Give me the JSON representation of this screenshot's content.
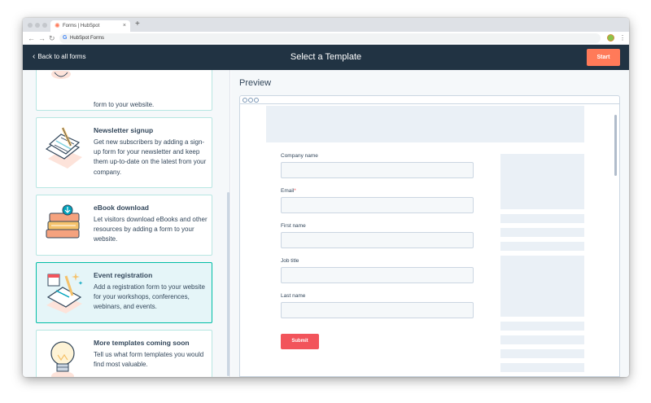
{
  "browser": {
    "tab_title": "Forms | HubSpot",
    "tab_close": "×",
    "new_tab": "+",
    "url": "HubSpot Forms",
    "google_glyph": "G",
    "nav": {
      "back": "←",
      "forward": "→",
      "reload": "↻"
    },
    "menu_glyph": "⋮"
  },
  "header": {
    "back_chevron": "‹",
    "back_label": "Back to all forms",
    "title": "Select a Template",
    "start_label": "Start"
  },
  "templates": [
    {
      "title": "",
      "description": "form to your website.",
      "selected": false,
      "icon": "contact-illustration-icon"
    },
    {
      "title": "Newsletter signup",
      "description": "Get new subscribers by adding a sign-up form for your newsletter and keep them up-to-date on the latest from your company.",
      "selected": false,
      "icon": "newsletter-illustration-icon"
    },
    {
      "title": "eBook download",
      "description": "Let visitors download eBooks and other resources by adding a form to your website.",
      "selected": false,
      "icon": "ebook-illustration-icon"
    },
    {
      "title": "Event registration",
      "description": "Add a registration form to your website for your workshops, conferences, webinars, and events.",
      "selected": true,
      "icon": "event-illustration-icon"
    },
    {
      "title": "More templates coming soon",
      "description": "Tell us what form templates you would find most valuable.",
      "selected": false,
      "icon": "lightbulb-illustration-icon"
    }
  ],
  "preview": {
    "title": "Preview",
    "fields": [
      {
        "label": "Company name",
        "required": false
      },
      {
        "label": "Email",
        "required": true
      },
      {
        "label": "First name",
        "required": false
      },
      {
        "label": "Job title",
        "required": false
      },
      {
        "label": "Last name",
        "required": false
      }
    ],
    "required_mark": "*",
    "submit_label": "Submit"
  },
  "colors": {
    "header_bg": "#213343",
    "accent_orange": "#ff7a59",
    "submit_red": "#f2545b",
    "selected_border": "#00bda5"
  }
}
